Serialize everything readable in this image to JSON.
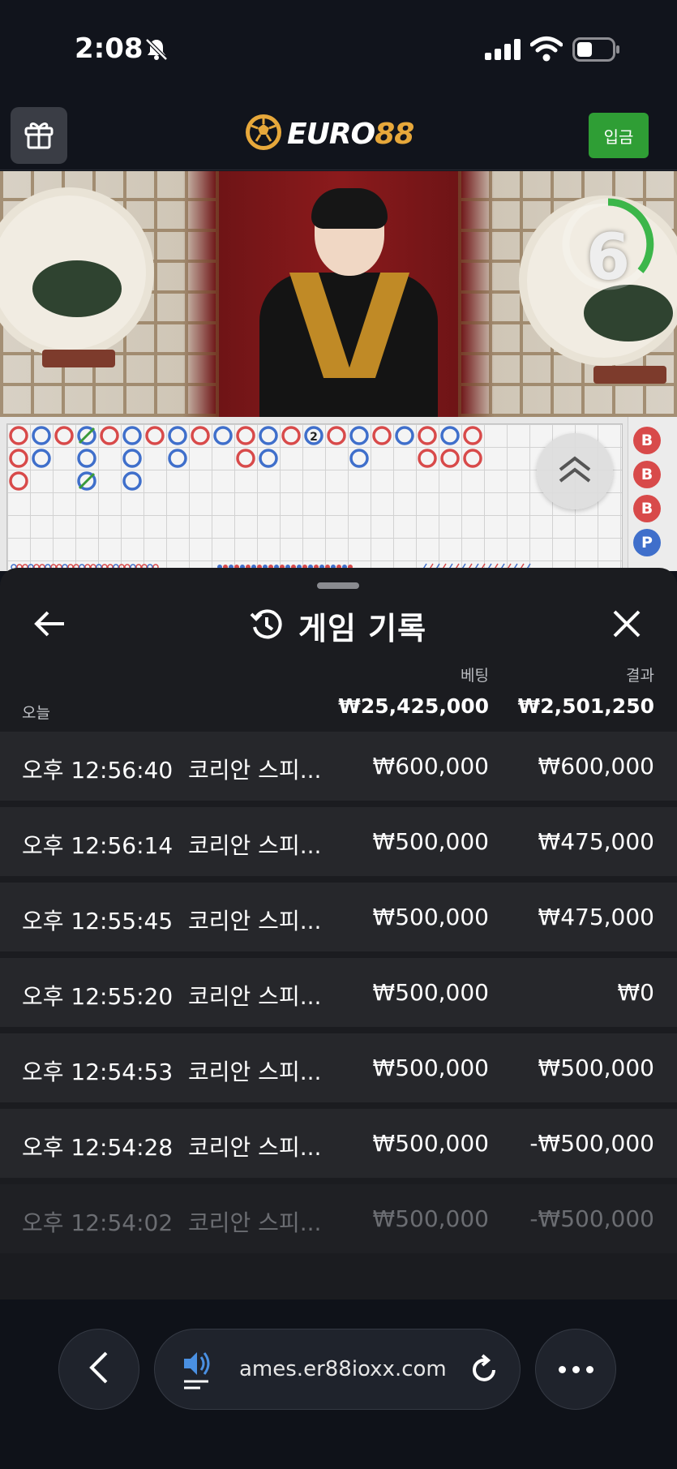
{
  "status_bar": {
    "time": "2:08"
  },
  "header": {
    "logo_part1": "EURO",
    "logo_part2": "88",
    "deposit_label": "입금"
  },
  "video": {
    "countdown": "6"
  },
  "scoreboard": {
    "side_beads": [
      "B",
      "B",
      "B",
      "P"
    ],
    "bead_colors": {
      "banker": "#d84a4a",
      "player": "#3f6fcb",
      "tie": "#3a9a3a"
    },
    "tie_marker": "2"
  },
  "sheet": {
    "title": "게임 기록",
    "bet_header": "베팅",
    "result_header": "결과",
    "today_label": "오늘",
    "total_bet": "₩25,425,000",
    "total_result": "₩2,501,250",
    "rows": [
      {
        "time": "오후 12:56:40",
        "game": "코리안 스피...",
        "bet": "₩600,000",
        "result": "₩600,000"
      },
      {
        "time": "오후 12:56:14",
        "game": "코리안 스피...",
        "bet": "₩500,000",
        "result": "₩475,000"
      },
      {
        "time": "오후 12:55:45",
        "game": "코리안 스피...",
        "bet": "₩500,000",
        "result": "₩475,000"
      },
      {
        "time": "오후 12:55:20",
        "game": "코리안 스피...",
        "bet": "₩500,000",
        "result": "₩0"
      },
      {
        "time": "오후 12:54:53",
        "game": "코리안 스피...",
        "bet": "₩500,000",
        "result": "₩500,000"
      },
      {
        "time": "오후 12:54:28",
        "game": "코리안 스피...",
        "bet": "₩500,000",
        "result": "-₩500,000"
      },
      {
        "time": "오후 12:54:02",
        "game": "코리안 스피...",
        "bet": "₩500,000",
        "result": "-₩500,000"
      }
    ]
  },
  "browser": {
    "url": "ames.er88ioxx.com"
  },
  "colors": {
    "accent_green": "#2f9e35",
    "logo_gold": "#e7a83b",
    "sheet_bg": "#1b1c20",
    "row_bg": "#26272b"
  }
}
